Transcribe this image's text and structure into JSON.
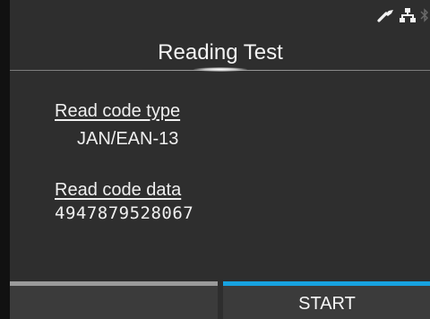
{
  "header": {
    "title": "Reading Test"
  },
  "status_icons": [
    "wrench-icon",
    "network-icon",
    "bluetooth-icon"
  ],
  "fields": {
    "code_type_label": "Read code type",
    "code_type_value": "JAN/EAN-13",
    "code_data_label": "Read code data",
    "code_data_value": "4947879528067"
  },
  "softkeys": {
    "left_label": "",
    "right_label": "START"
  },
  "colors": {
    "accent": "#17a2e0",
    "background": "#2e2e2e",
    "text": "#f0f0f0"
  }
}
